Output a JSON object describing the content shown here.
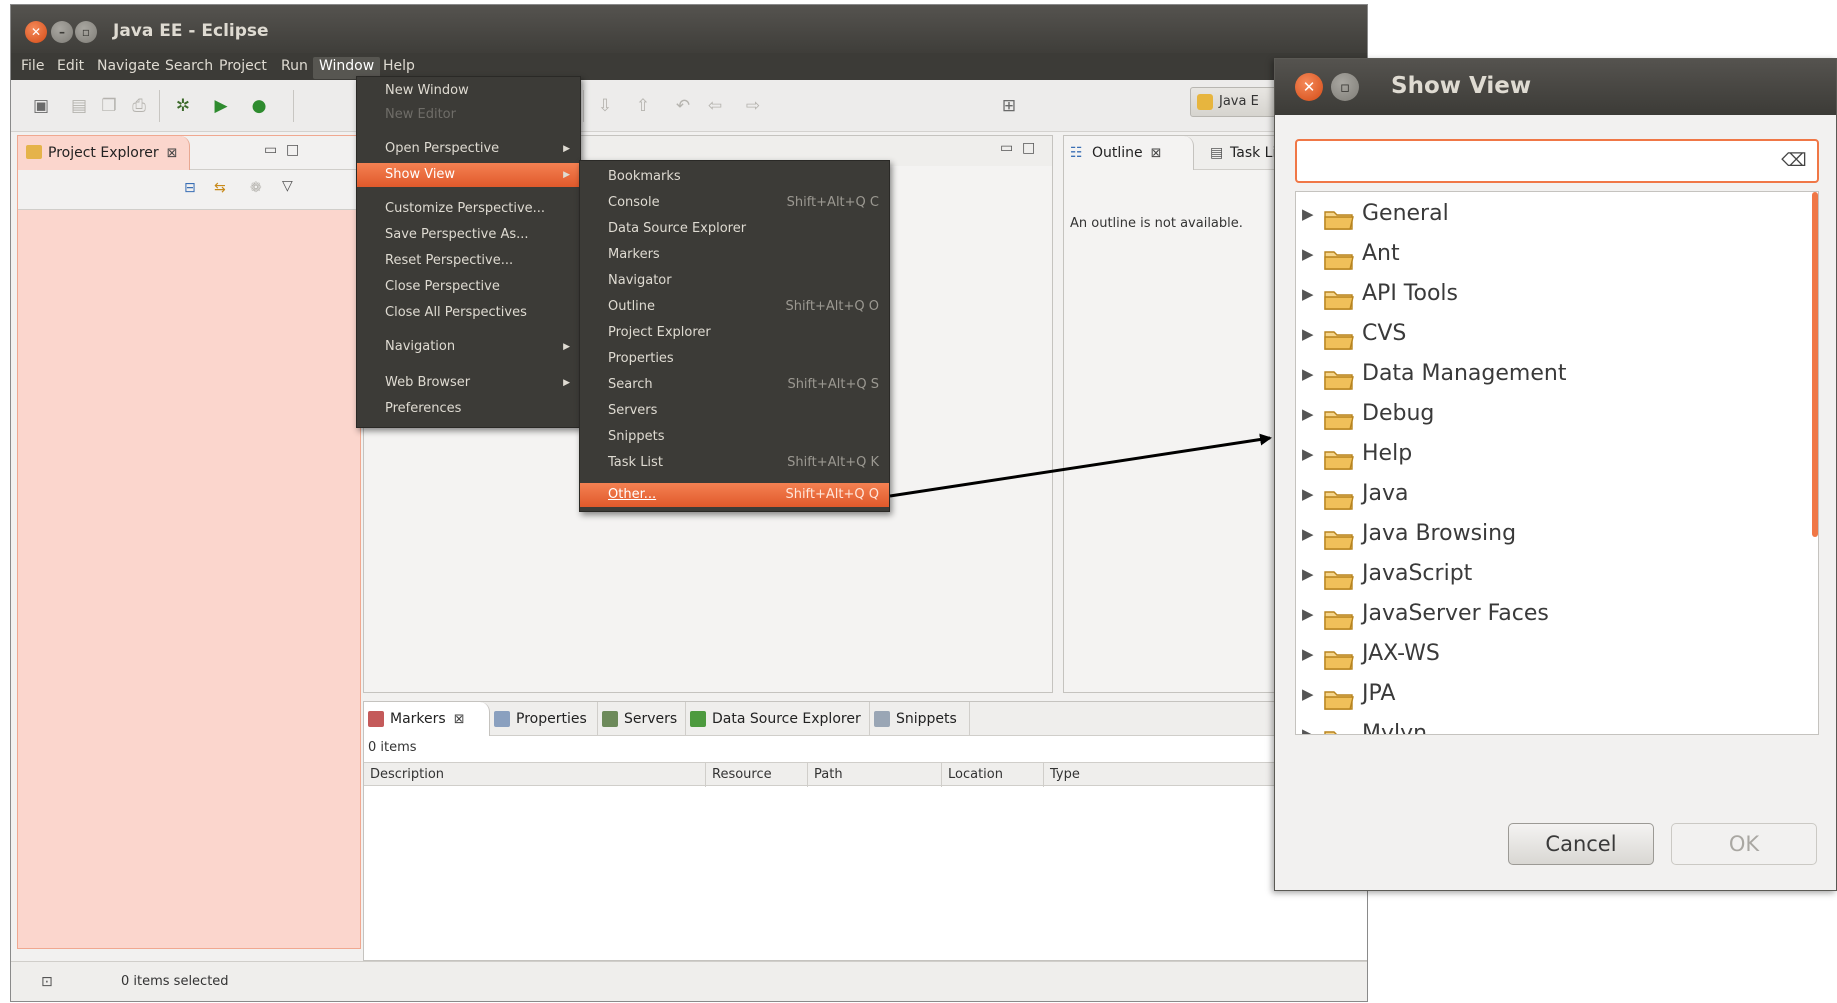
{
  "window": {
    "title": "Java EE - Eclipse"
  },
  "menubar": [
    "File",
    "Edit",
    "Navigate",
    "Search",
    "Project",
    "Run",
    "Window",
    "Help"
  ],
  "window_menu": {
    "items": [
      {
        "label": "New Window"
      },
      {
        "label": "New Editor",
        "disabled": true
      },
      {
        "label": "Open Perspective",
        "submenu": true
      },
      {
        "label": "Show View",
        "submenu": true,
        "highlighted": true
      },
      {
        "label": "Customize Perspective..."
      },
      {
        "label": "Save Perspective As..."
      },
      {
        "label": "Reset Perspective..."
      },
      {
        "label": "Close Perspective"
      },
      {
        "label": "Close All Perspectives"
      },
      {
        "label": "Navigation",
        "submenu": true
      },
      {
        "label": "Web Browser",
        "submenu": true
      },
      {
        "label": "Preferences"
      }
    ]
  },
  "show_view_menu": {
    "items": [
      {
        "label": "Bookmarks",
        "shortcut": ""
      },
      {
        "label": "Console",
        "shortcut": "Shift+Alt+Q C"
      },
      {
        "label": "Data Source Explorer",
        "shortcut": ""
      },
      {
        "label": "Markers",
        "shortcut": ""
      },
      {
        "label": "Navigator",
        "shortcut": ""
      },
      {
        "label": "Outline",
        "shortcut": "Shift+Alt+Q O"
      },
      {
        "label": "Project Explorer",
        "shortcut": ""
      },
      {
        "label": "Properties",
        "shortcut": ""
      },
      {
        "label": "Search",
        "shortcut": "Shift+Alt+Q S"
      },
      {
        "label": "Servers",
        "shortcut": ""
      },
      {
        "label": "Snippets",
        "shortcut": ""
      },
      {
        "label": "Task List",
        "shortcut": "Shift+Alt+Q K"
      },
      {
        "label": "Other...",
        "shortcut": "Shift+Alt+Q Q",
        "highlighted": true
      }
    ]
  },
  "perspective_button": "Java E",
  "project_explorer": {
    "tab": "Project Explorer"
  },
  "outline": {
    "tab": "Outline",
    "tab2": "Task Lis",
    "message": "An outline is not available."
  },
  "markers": {
    "tabs": [
      "Markers",
      "Properties",
      "Servers",
      "Data Source Explorer",
      "Snippets"
    ],
    "count": "0 items",
    "columns": [
      "Description",
      "Resource",
      "Path",
      "Location",
      "Type"
    ]
  },
  "status": {
    "text": "0 items selected"
  },
  "dialog": {
    "title": "Show View",
    "filter_value": "",
    "categories": [
      "General",
      "Ant",
      "API Tools",
      "CVS",
      "Data Management",
      "Debug",
      "Help",
      "Java",
      "Java Browsing",
      "JavaScript",
      "JavaServer Faces",
      "JAX-WS",
      "JPA",
      "Mylyn"
    ],
    "cancel": "Cancel",
    "ok": "OK"
  },
  "colors": {
    "accent": "#e0592b",
    "menu_bg": "#3c3b37",
    "explorer_bg": "#fbd6cd",
    "folder": "#e6a53a"
  }
}
